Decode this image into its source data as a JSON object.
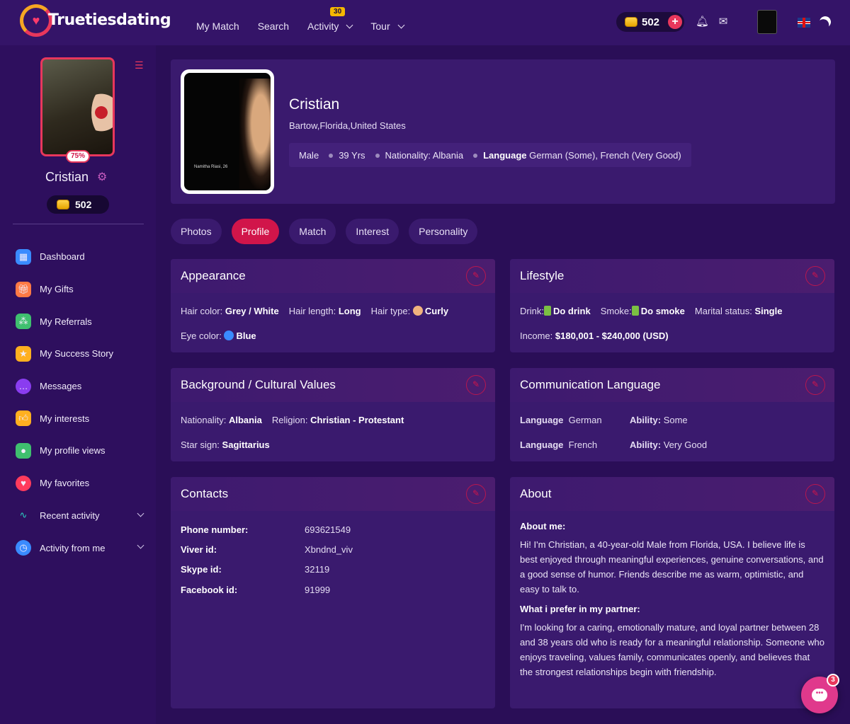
{
  "brand": {
    "name": "Truetiesdating"
  },
  "nav": {
    "items": [
      {
        "label": "My Match",
        "has_dropdown": false
      },
      {
        "label": "Search",
        "has_dropdown": false
      },
      {
        "label": "Activity",
        "has_dropdown": true,
        "badge": "30"
      },
      {
        "label": "Tour",
        "has_dropdown": true
      }
    ]
  },
  "topbar": {
    "coins": "502",
    "icons": [
      "bell-icon",
      "mail-icon",
      "uk-flag-icon",
      "moon-icon"
    ]
  },
  "sidebar": {
    "profile_percent": "75%",
    "name": "Cristian",
    "coins": "502",
    "items": [
      {
        "label": "Dashboard",
        "icon": "dashboard-icon",
        "color": "#4aa3ff"
      },
      {
        "label": "My Gifts",
        "icon": "gift-icon",
        "color": "#ff7a45"
      },
      {
        "label": "My Referrals",
        "icon": "referrals-icon",
        "color": "#3fbf6f"
      },
      {
        "label": "My Success Story",
        "icon": "success-story-icon",
        "color": "#ffb020"
      },
      {
        "label": "Messages",
        "icon": "messages-icon",
        "color": "#8a3df0"
      },
      {
        "label": "My interests",
        "icon": "thumbs-up-icon",
        "color": "#ffb020"
      },
      {
        "label": "My profile views",
        "icon": "profile-views-icon",
        "color": "#3fbf6f"
      },
      {
        "label": "My favorites",
        "icon": "heart-icon",
        "color": "#ff3b5c"
      },
      {
        "label": "Recent activity",
        "icon": "pulse-icon",
        "color": "#2ad1c0",
        "expandable": true
      },
      {
        "label": "Activity from me",
        "icon": "clock-icon",
        "color": "#3a8bff",
        "expandable": true
      }
    ]
  },
  "profile": {
    "name": "Cristian",
    "location": "Bartow,Florida,United States",
    "gender": "Male",
    "age": "39 Yrs",
    "nationality_tag": "Nationality: Albania",
    "language_label": "Language",
    "language_value": "German (Some), French (Very Good)",
    "photo_caption": "Namitha Riasi, 26"
  },
  "tabs": [
    "Photos",
    "Profile",
    "Match",
    "Interest",
    "Personality"
  ],
  "appearance": {
    "title": "Appearance",
    "hair_color_label": "Hair color:",
    "hair_color": "Grey / White",
    "hair_length_label": "Hair length:",
    "hair_length": "Long",
    "hair_type_label": "Hair type:",
    "hair_type": "Curly",
    "eye_color_label": "Eye color:",
    "eye_color": "Blue"
  },
  "lifestyle": {
    "title": "Lifestyle",
    "drink_label": "Drink:",
    "drink": "Do drink",
    "smoke_label": "Smoke:",
    "smoke": "Do smoke",
    "marital_label": "Marital status:",
    "marital": "Single",
    "income_label": "Income:",
    "income": "$180,001 - $240,000 (USD)"
  },
  "background": {
    "title": "Background / Cultural Values",
    "nationality_label": "Nationality:",
    "nationality": "Albania",
    "religion_label": "Religion:",
    "religion": "Christian - Protestant",
    "star_label": "Star sign:",
    "star": "Sagittarius"
  },
  "communication": {
    "title": "Communication Language",
    "rows": [
      {
        "lang_label": "Language",
        "lang": "German",
        "ability_label": "Ability:",
        "ability": "Some"
      },
      {
        "lang_label": "Language",
        "lang": "French",
        "ability_label": "Ability:",
        "ability": "Very Good"
      }
    ]
  },
  "contacts": {
    "title": "Contacts",
    "rows": [
      {
        "label": "Phone number:",
        "value": "693621549"
      },
      {
        "label": "Viver id:",
        "value": "Xbndnd_viv"
      },
      {
        "label": "Skype id:",
        "value": "32119"
      },
      {
        "label": "Facebook id:",
        "value": "91999"
      }
    ]
  },
  "about": {
    "title": "About",
    "me_label": "About me:",
    "me_text": "Hi! I'm Christian, a 40-year-old Male from Florida, USA. I believe life is best enjoyed through meaningful experiences, genuine conversations, and a good sense of humor. Friends describe me as warm, optimistic, and easy to talk to.",
    "partner_label": "What i prefer in my partner:",
    "partner_text": "I'm looking for a caring, emotionally mature, and loyal partner between 28 and 38 years old who is ready for a meaningful relationship. Someone who enjoys traveling, values family, communicates openly, and believes that the strongest relationships begin with friendship."
  },
  "chat": {
    "unread": "3"
  },
  "colors": {
    "accent": "#d1154a",
    "background": "#2a0e57",
    "card": "#3a1a6e",
    "sidebar": "#2e0f5e"
  }
}
